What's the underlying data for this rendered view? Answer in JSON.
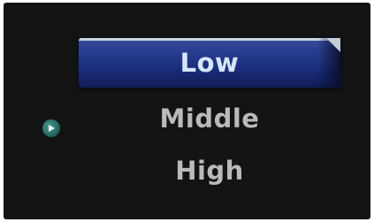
{
  "menu": {
    "options": [
      {
        "label": "Low",
        "selected": true
      },
      {
        "label": "Middle",
        "selected": false
      },
      {
        "label": "High",
        "selected": false
      }
    ],
    "pointer_icon": "play-arrow-icon"
  },
  "colors": {
    "background": "#121312",
    "selection_fill": "#1c2f7d",
    "selected_text": "#d6e6fb",
    "option_text": "#b9bab9",
    "pointer": "#2f7a6d"
  }
}
